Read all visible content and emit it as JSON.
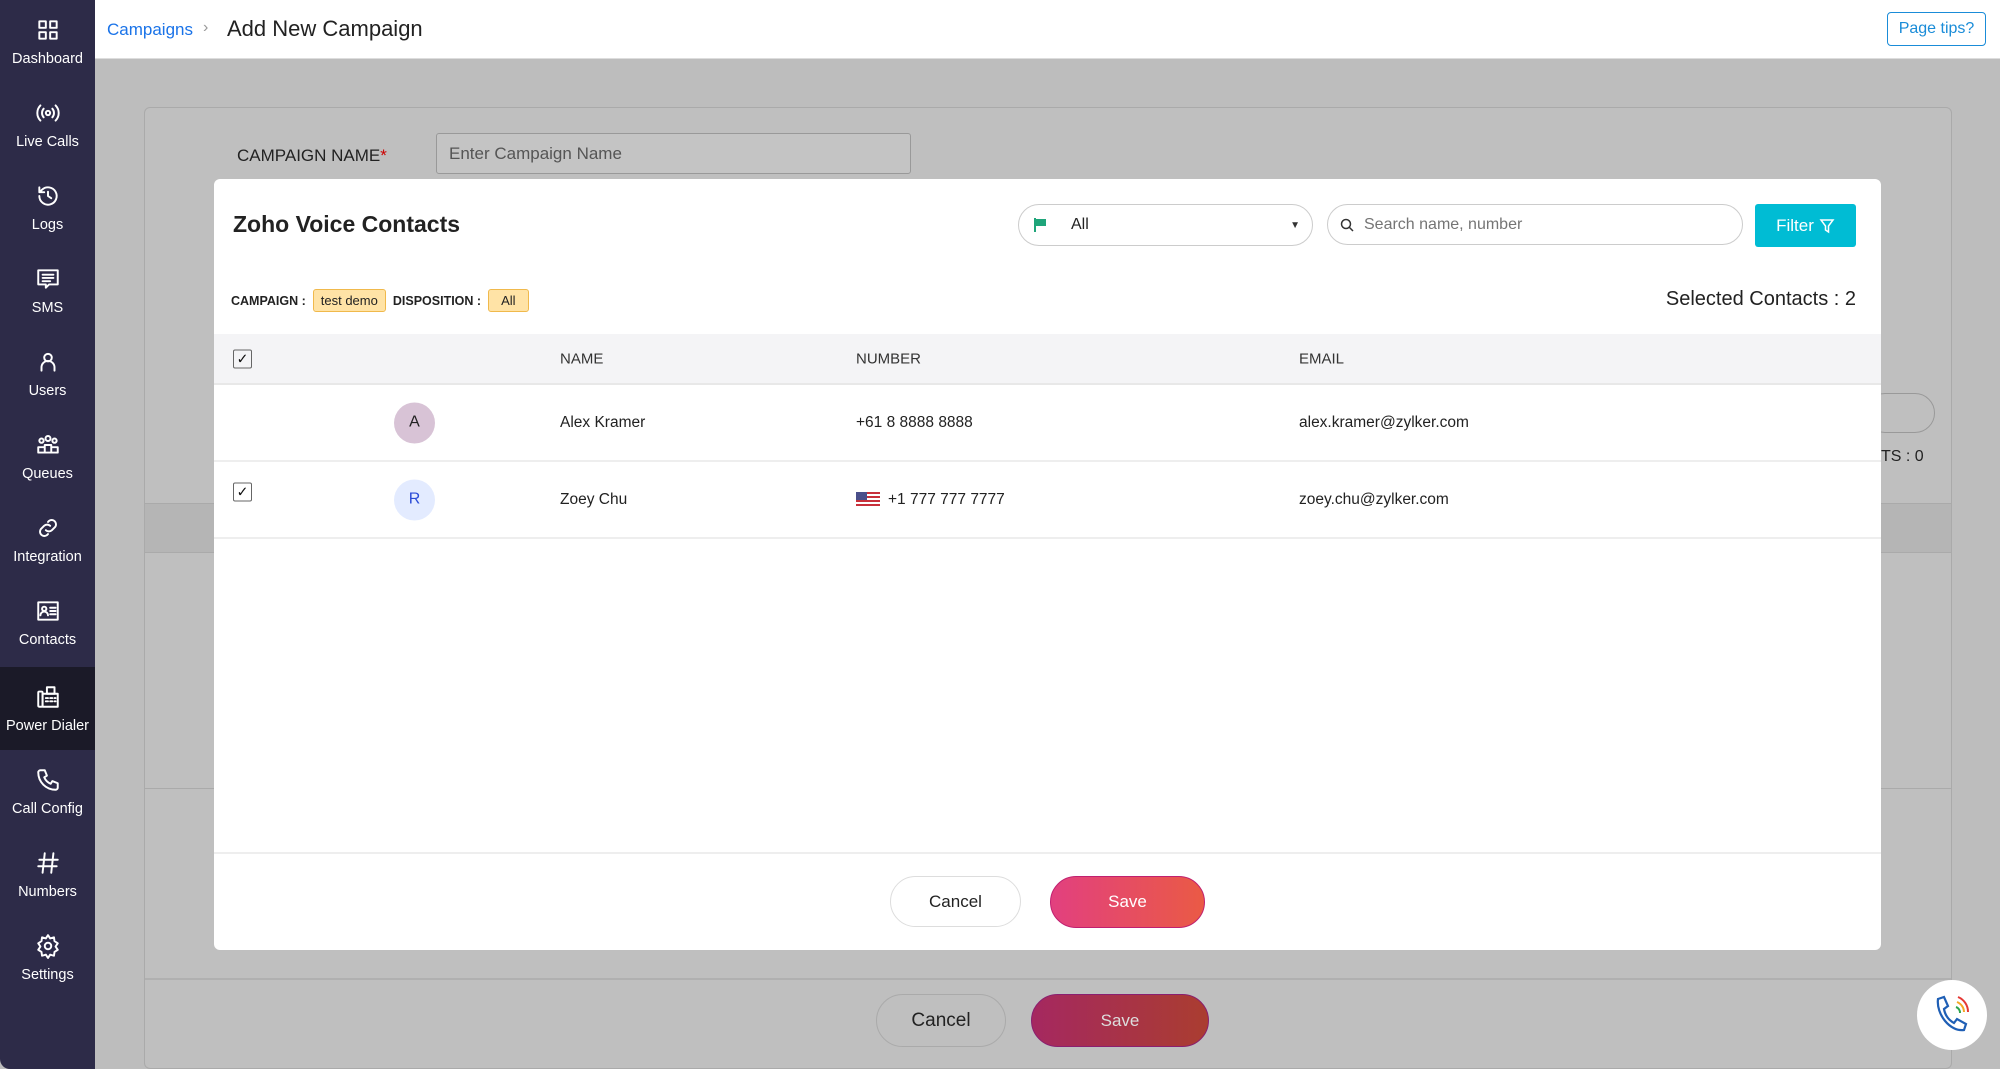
{
  "sidebar": {
    "items": [
      {
        "label": "Dashboard",
        "icon": "grid-icon"
      },
      {
        "label": "Live Calls",
        "icon": "broadcast-icon"
      },
      {
        "label": "Logs",
        "icon": "history-icon"
      },
      {
        "label": "SMS",
        "icon": "message-icon"
      },
      {
        "label": "Users",
        "icon": "user-icon"
      },
      {
        "label": "Queues",
        "icon": "group-icon"
      },
      {
        "label": "Integration",
        "icon": "link-icon"
      },
      {
        "label": "Contacts",
        "icon": "contact-card-icon"
      },
      {
        "label": "Power Dialer",
        "icon": "fax-icon",
        "active": true
      },
      {
        "label": "Call Config",
        "icon": "phone-icon"
      },
      {
        "label": "Numbers",
        "icon": "hash-icon"
      },
      {
        "label": "Settings",
        "icon": "gear-icon"
      }
    ]
  },
  "header": {
    "breadcrumb": "Campaigns",
    "separator": "›",
    "title": "Add New Campaign",
    "page_tips": "Page tips?"
  },
  "background_form": {
    "campaign_name_label": "CAMPAIGN NAME",
    "required_mark": "*",
    "campaign_name_placeholder": "Enter Campaign Name",
    "contacts_count_fragment": "TS : 0",
    "cancel": "Cancel",
    "save": "Save"
  },
  "modal": {
    "title": "Zoho Voice Contacts",
    "dropdown_value": "All",
    "search_placeholder": "Search name, number",
    "filter_label": "Filter",
    "campaign_label": "CAMPAIGN :",
    "campaign_value": "test demo",
    "disposition_label": "DISPOSITION :",
    "disposition_value": "All",
    "selected_contacts": "Selected Contacts : 2",
    "columns": {
      "name": "NAME",
      "number": "NUMBER",
      "email": "EMAIL"
    },
    "rows": [
      {
        "initial": "A",
        "name": "Alex Kramer",
        "number": "+61 8 8888 8888",
        "email": "alex.kramer@zylker.com",
        "checked": false,
        "avatar_bg": "#d8c3d6",
        "avatar_fg": "#222"
      },
      {
        "initial": "R",
        "name": "Zoey Chu",
        "number": "+1 777 777 7777",
        "email": "zoey.chu@zylker.com",
        "checked": true,
        "flag": "us-flag-icon",
        "avatar_bg": "#e3ebff",
        "avatar_fg": "#2a4bd7"
      }
    ],
    "cancel": "Cancel",
    "save": "Save"
  },
  "colors": {
    "sidebar": "#2d2b48",
    "accent": "#00bcd4",
    "link": "#1a73e8"
  }
}
